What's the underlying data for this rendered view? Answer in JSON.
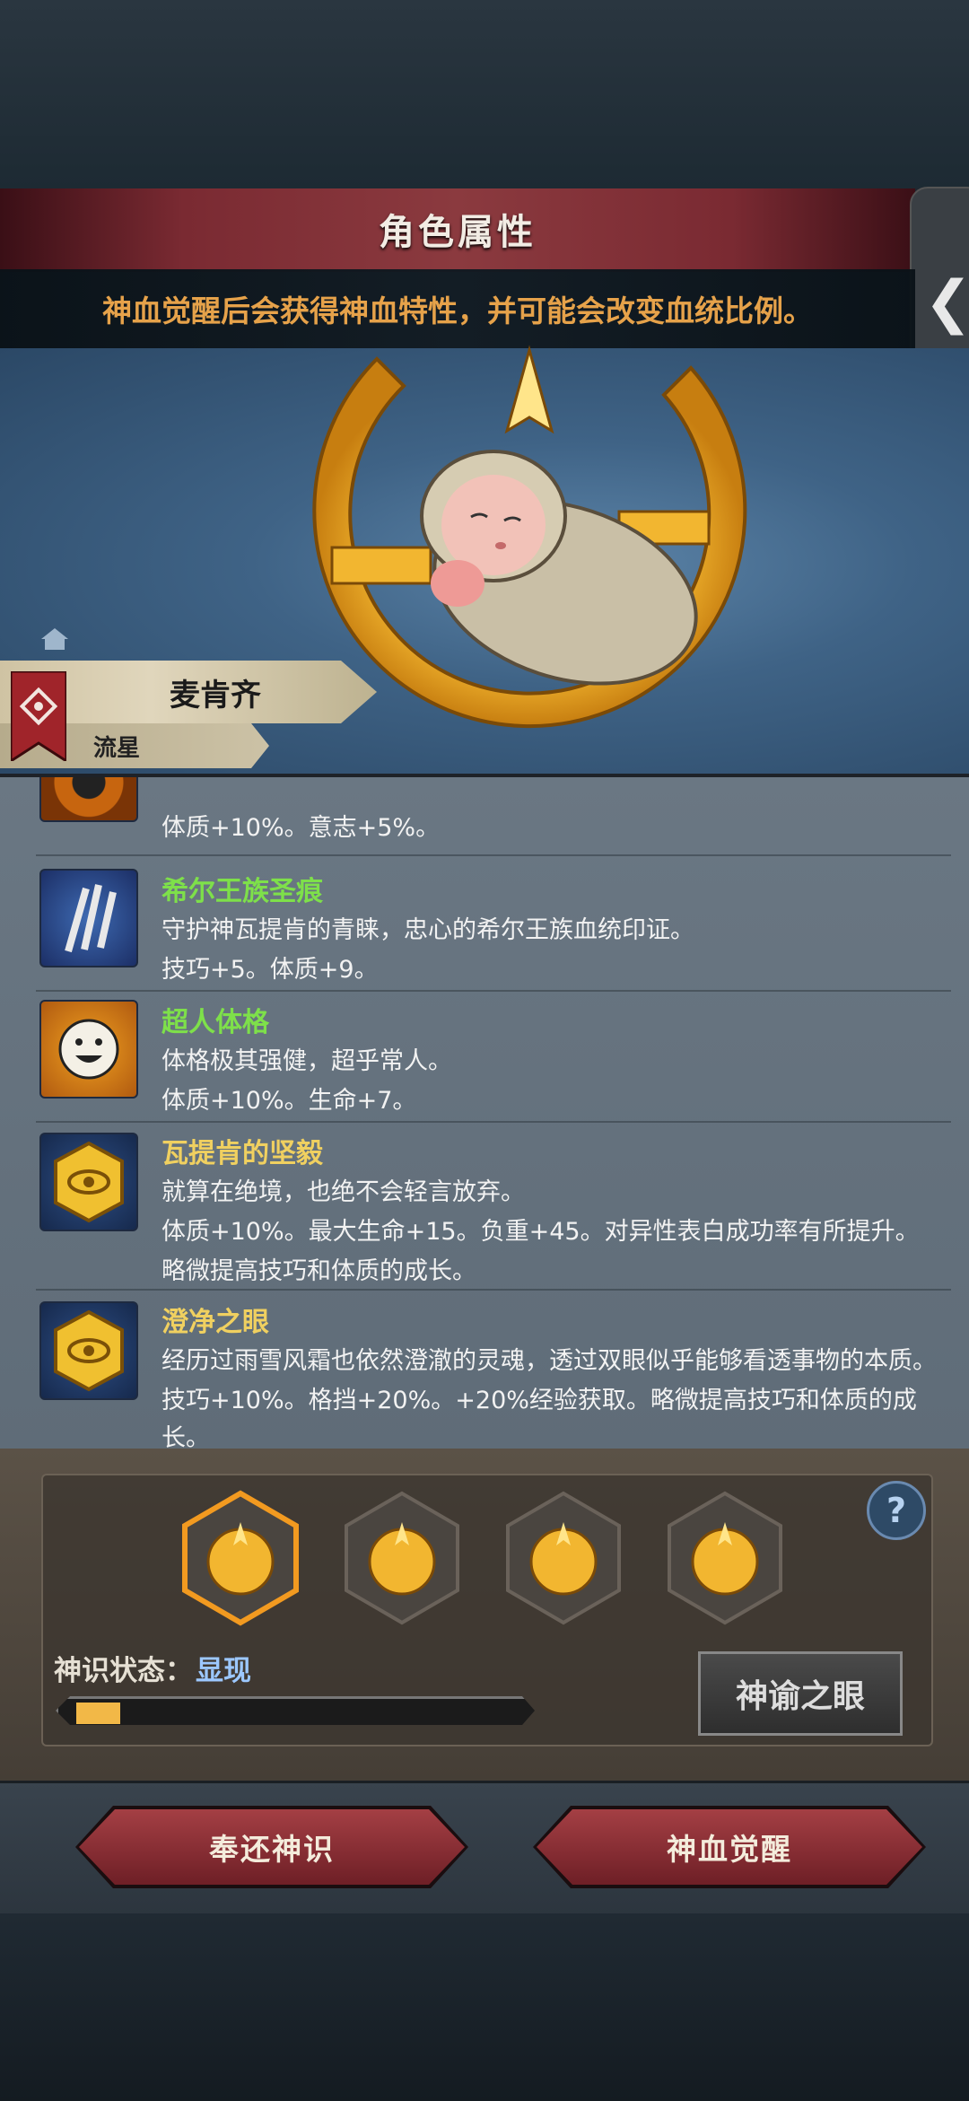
{
  "header": {
    "title": "角色属性",
    "notice": "神血觉醒后会获得神血特性，并可能会改变血统比例。"
  },
  "character": {
    "name": "麦肯齐",
    "title": "流星"
  },
  "traits": [
    {
      "name": "",
      "desc": "",
      "effects": "体质+10%。意志+5%。",
      "name_color": "gold"
    },
    {
      "name": "希尔王族圣痕",
      "desc": "守护神瓦提肯的青睐，忠心的希尔王族血统印证。",
      "effects": "技巧+5。体质+9。",
      "name_color": "green"
    },
    {
      "name": "超人体格",
      "desc": "体格极其强健，超乎常人。",
      "effects": "体质+10%。生命+7。",
      "name_color": "green"
    },
    {
      "name": "瓦提肯的坚毅",
      "desc": "就算在绝境，也绝不会轻言放弃。",
      "effects": "体质+10%。最大生命+15。负重+45。对异性表白成功率有所提升。",
      "effects2": "略微提高技巧和体质的成长。",
      "name_color": "gold"
    },
    {
      "name": "澄净之眼",
      "desc": "经历过雨雪风霜也依然澄澈的灵魂，透过双眼似乎能够看透事物的本质。",
      "effects": "技巧+10%。格挡+20%。+20%经验获取。略微提高技巧和体质的成",
      "effects2": "长。",
      "name_color": "gold"
    }
  ],
  "divine": {
    "state_label": "神识状态：",
    "state_value": "显现",
    "progress": 0.1,
    "oracle_button": "神谕之眼",
    "help": "?"
  },
  "actions": {
    "return_label": "奉还神识",
    "awaken_label": "神血觉醒"
  },
  "colors": {
    "accent_gold": "#f2b847",
    "trait_green": "#7ee04a",
    "trait_gold": "#f0d060",
    "button_red": "#8b2d33"
  }
}
